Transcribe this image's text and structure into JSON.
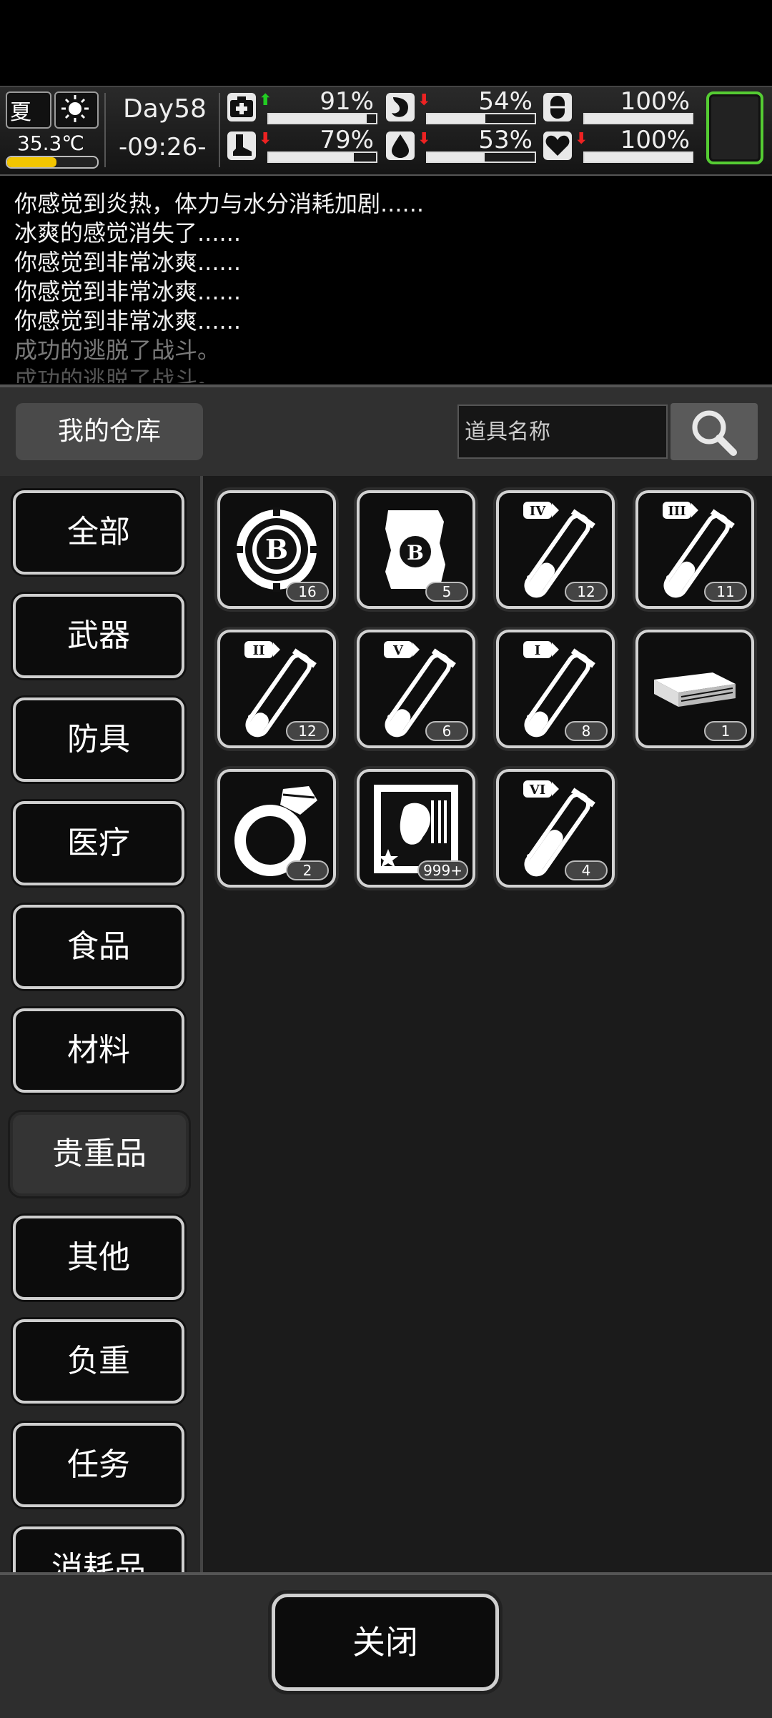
{
  "hud": {
    "season": "夏",
    "temperature": "35.3℃",
    "temperature_fill": 0.55,
    "day": "Day58",
    "time": "-09:26-",
    "stats": [
      {
        "name": "health-icon",
        "value": "91%",
        "fill": 0.91,
        "trend": "up",
        "trend_color": "#22cc22"
      },
      {
        "name": "stomach-icon",
        "value": "54%",
        "fill": 0.54,
        "trend": "down",
        "trend_color": "#ee2222"
      },
      {
        "name": "capsule-icon",
        "value": "100%",
        "fill": 1.0,
        "trend": "none",
        "trend_color": ""
      },
      {
        "name": "boot-icon",
        "value": "79%",
        "fill": 0.79,
        "trend": "down",
        "trend_color": "#ee2222"
      },
      {
        "name": "water-drop-icon",
        "value": "53%",
        "fill": 0.53,
        "trend": "down",
        "trend_color": "#ee2222"
      },
      {
        "name": "heart-icon",
        "value": "100%",
        "fill": 1.0,
        "trend": "down",
        "trend_color": "#ee2222"
      }
    ],
    "portrait_border_color": "#55cc33"
  },
  "log": {
    "lines": [
      "你感觉到炎热，体力与水分消耗加剧......",
      "冰爽的感觉消失了......",
      "你感觉到非常冰爽......",
      "你感觉到非常冰爽......",
      "你感觉到非常冰爽......",
      "成功的逃脱了战斗。",
      "成功的逃脱了战斗。"
    ]
  },
  "warehouse": {
    "title": "我的仓库",
    "search_placeholder": "道具名称"
  },
  "categories": [
    "全部",
    "武器",
    "防具",
    "医疗",
    "食品",
    "材料",
    "贵重品",
    "其他",
    "负重",
    "任务",
    "消耗品"
  ],
  "active_category": "贵重品",
  "items": [
    {
      "icon": "bitcoin-chip-icon",
      "count": "16"
    },
    {
      "icon": "bitcoin-note-icon",
      "count": "5"
    },
    {
      "icon": "test-tube-iv-icon",
      "count": "12"
    },
    {
      "icon": "test-tube-iii-icon",
      "count": "11"
    },
    {
      "icon": "test-tube-ii-icon",
      "count": "12"
    },
    {
      "icon": "test-tube-v-icon",
      "count": "6"
    },
    {
      "icon": "test-tube-i-icon",
      "count": "8"
    },
    {
      "icon": "cash-stack-icon",
      "count": "1"
    },
    {
      "icon": "diamond-ring-icon",
      "count": "2"
    },
    {
      "icon": "zombie-card-icon",
      "count": "999+"
    },
    {
      "icon": "test-tube-vi-icon",
      "count": "4"
    }
  ],
  "footer": {
    "close_label": "关闭"
  }
}
